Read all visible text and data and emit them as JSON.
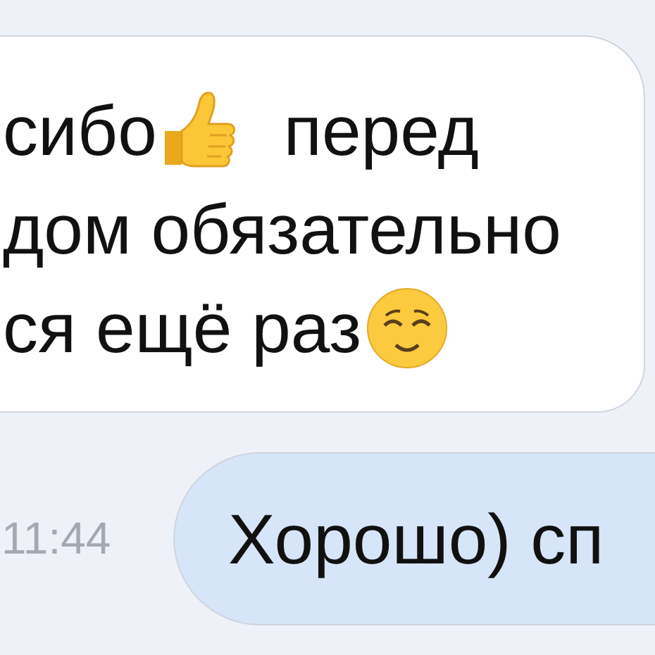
{
  "messages": [
    {
      "kind": "incoming",
      "lines": [
        [
          {
            "kind": "text",
            "text": "сибо"
          },
          {
            "kind": "thumbs-up"
          },
          {
            "kind": "text",
            "text": "перед"
          }
        ],
        [
          {
            "kind": "text",
            "text": "дом обязательно"
          }
        ],
        [
          {
            "kind": "text",
            "text": "ся ещё раз"
          },
          {
            "kind": "relieved-face"
          }
        ]
      ]
    },
    {
      "kind": "outgoing",
      "time": "11:44",
      "lines": [
        [
          {
            "kind": "text",
            "text": "Хорошо) сп"
          }
        ]
      ]
    }
  ]
}
